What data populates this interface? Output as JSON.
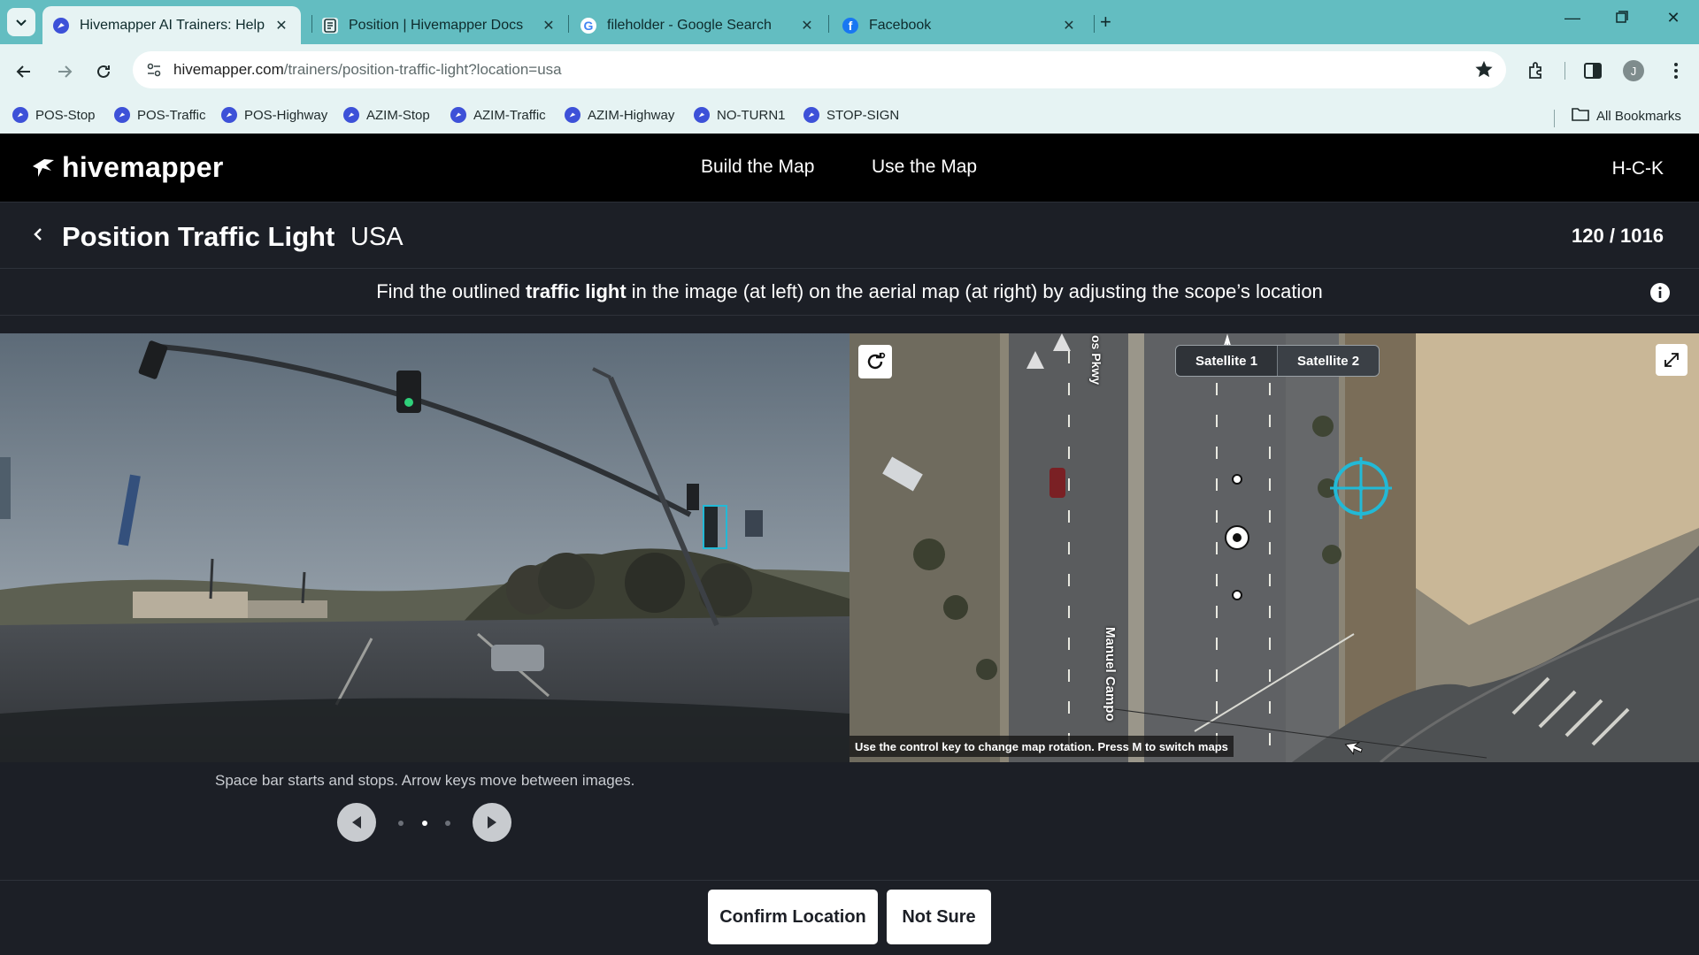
{
  "browser": {
    "tabs": [
      {
        "title": "Hivemapper AI Trainers: Help Va",
        "favicon": "hivemapper-icon",
        "active": true
      },
      {
        "title": "Position | Hivemapper Docs",
        "favicon": "docs-icon",
        "active": false
      },
      {
        "title": "fileholder - Google Search",
        "favicon": "google-icon",
        "active": false
      },
      {
        "title": "Facebook",
        "favicon": "facebook-icon",
        "active": false
      }
    ],
    "url_host": "hivemapper.com",
    "url_path": "/trainers/position-traffic-light?location=usa",
    "profile_initial": "J",
    "bookmarks": [
      "POS-Stop",
      "POS-Traffic",
      "POS-Highway",
      "AZIM-Stop",
      "AZIM-Traffic",
      "AZIM-Highway",
      "NO-TURN1",
      "STOP-SIGN"
    ],
    "all_bookmarks_label": "All Bookmarks"
  },
  "app": {
    "logo_text": "hivemapper",
    "nav": [
      "Build the Map",
      "Use the Map"
    ],
    "user_initials": "H-C-K",
    "title": "Position Traffic Light",
    "subtitle": "USA",
    "counter": "120 / 1016",
    "instruction": {
      "before": "Find the outlined ",
      "bold": "traffic light",
      "after": " in the image (at left) on the aerial map (at right) by adjusting the scope’s location"
    },
    "map": {
      "layers": [
        "Satellite 1",
        "Satellite 2"
      ],
      "active_layer": "Satellite 2",
      "hint": "Use the control key to change map rotation. Press M to switch maps",
      "street_labels": [
        "os Pkwy",
        "Manuel Campo"
      ]
    },
    "helper_text": "Space bar starts and stops. Arrow keys move between images.",
    "image_position": {
      "index": 2,
      "total": 3
    },
    "actions": {
      "confirm": "Confirm Location",
      "not_sure": "Not Sure"
    },
    "colors": {
      "accent_cyan": "#22b9d6",
      "header_bg": "#000000",
      "page_bg": "#1c1f26",
      "browser_frame": "#63bdc1"
    }
  }
}
